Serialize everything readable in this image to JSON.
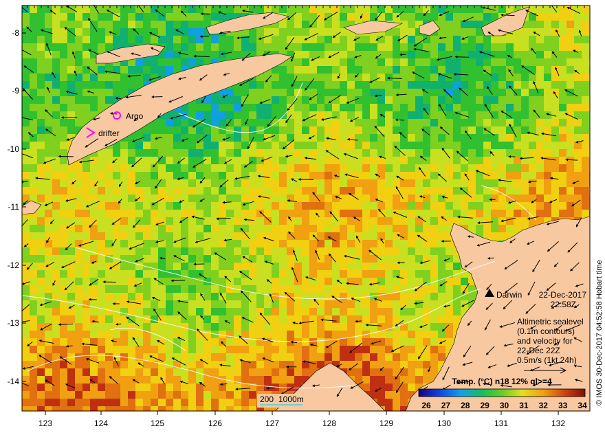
{
  "map": {
    "latitude_ticks": [
      "-8",
      "-9",
      "-10",
      "-11",
      "-12",
      "-13",
      "-14"
    ],
    "longitude_ticks": [
      "123",
      "124",
      "125",
      "126",
      "127",
      "128",
      "129",
      "130",
      "131",
      "132"
    ],
    "land_color": "#f8c8a0"
  },
  "annotations": {
    "argo_label": "Argo",
    "drifter_label": "drifter",
    "marker_color": "#ff00ff",
    "city_name": "Darwin",
    "date": "22-Dec-2017",
    "time": "22:58Z"
  },
  "info_box": {
    "lines": [
      "Altimetric sealevel",
      "(0.1m contours)",
      "and velocity for",
      "22-Dec 22Z",
      "0.5m/s (1kt 24h)"
    ]
  },
  "depth_legend": {
    "label_200": "200",
    "label_1000": "1000m",
    "color": "#40d0e0"
  },
  "colorbar": {
    "title": "Temp. (°C) n18 12% ql>=4",
    "ticks": [
      "26",
      "27",
      "28",
      "29",
      "30",
      "31",
      "32",
      "33",
      "34"
    ]
  },
  "credit": "© IMOS 30-Dec-2017 04:52:58 Hobart time"
}
